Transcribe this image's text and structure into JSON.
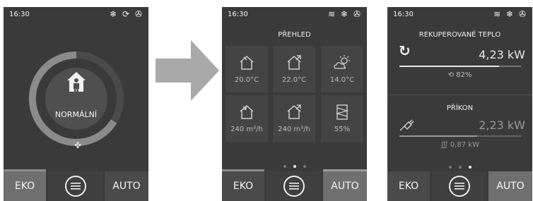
{
  "screens": [
    {
      "time": "16:30",
      "mode_label": "NORMÁLNÍ",
      "buttons": {
        "left": "EKO",
        "right": "AUTO"
      }
    },
    {
      "time": "16:30",
      "title": "PŘEHLED",
      "tiles": [
        {
          "icon": "house-in-icon",
          "value": "20.0°C"
        },
        {
          "icon": "house-out-icon",
          "value": "22.0°C"
        },
        {
          "icon": "weather-icon",
          "value": "14.0°C"
        },
        {
          "icon": "house-supply-icon",
          "value": "240 m³/h"
        },
        {
          "icon": "house-exhaust-icon",
          "value": "240 m³/h"
        },
        {
          "icon": "filter-icon",
          "value": "55%"
        }
      ],
      "buttons": {
        "left": "EKO",
        "right": "AUTO"
      }
    },
    {
      "time": "16:30",
      "section1": {
        "title": "REKUPEROVANÉ TEPLO",
        "value": "4,23 kW",
        "efficiency": "82%",
        "bar_fraction": 0.82
      },
      "section2": {
        "title": "PŘÍKON",
        "value": "2,23 kW",
        "heater": "0,87 kW",
        "bar_fraction": 0.64
      },
      "buttons": {
        "left": "EKO",
        "right": "AUTO"
      }
    }
  ],
  "ring_fraction": 0.6
}
